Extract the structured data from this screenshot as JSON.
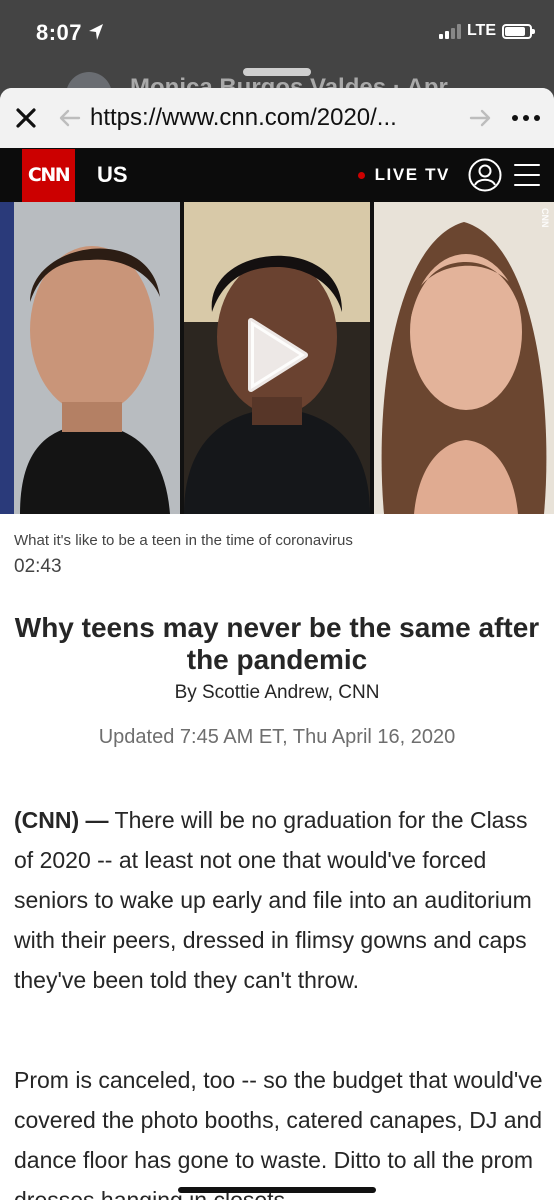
{
  "status_bar": {
    "time": "8:07",
    "network": "LTE",
    "battery_level": 0.85
  },
  "background_sheet": {
    "name_text": "Monica Burgos Valdes · Apr"
  },
  "browser": {
    "url": "https://www.cnn.com/2020/...",
    "close_icon": "close-icon",
    "back_icon": "arrow-left-icon",
    "forward_icon": "arrow-right-icon",
    "more_icon": "more-horizontal-icon"
  },
  "site_header": {
    "logo": "CNN",
    "section": "US",
    "live_tv": "LIVE TV",
    "live_color": "#cc0000",
    "brand_color": "#cc0000"
  },
  "video": {
    "watermark": "CNN",
    "caption": "What it's like to be a teen in the time of coronavirus",
    "duration": "02:43"
  },
  "article": {
    "headline": "Why teens may never be the same after the pandemic",
    "byline": "By Scottie Andrew, CNN",
    "updated": "Updated 7:45 AM ET, Thu April 16, 2020",
    "dateline": "(CNN) —",
    "paragraph1": "There will be no graduation for the Class of 2020 -- at least not one that would've forced seniors to wake up early and file into an auditorium with their peers, dressed in flimsy gowns and caps they've been told they can't throw.",
    "paragraph2": "Prom is canceled, too -- so the budget that would've covered the photo booths, catered canapes, DJ and dance floor has gone to waste. Ditto to all the prom dresses hanging in closets"
  }
}
